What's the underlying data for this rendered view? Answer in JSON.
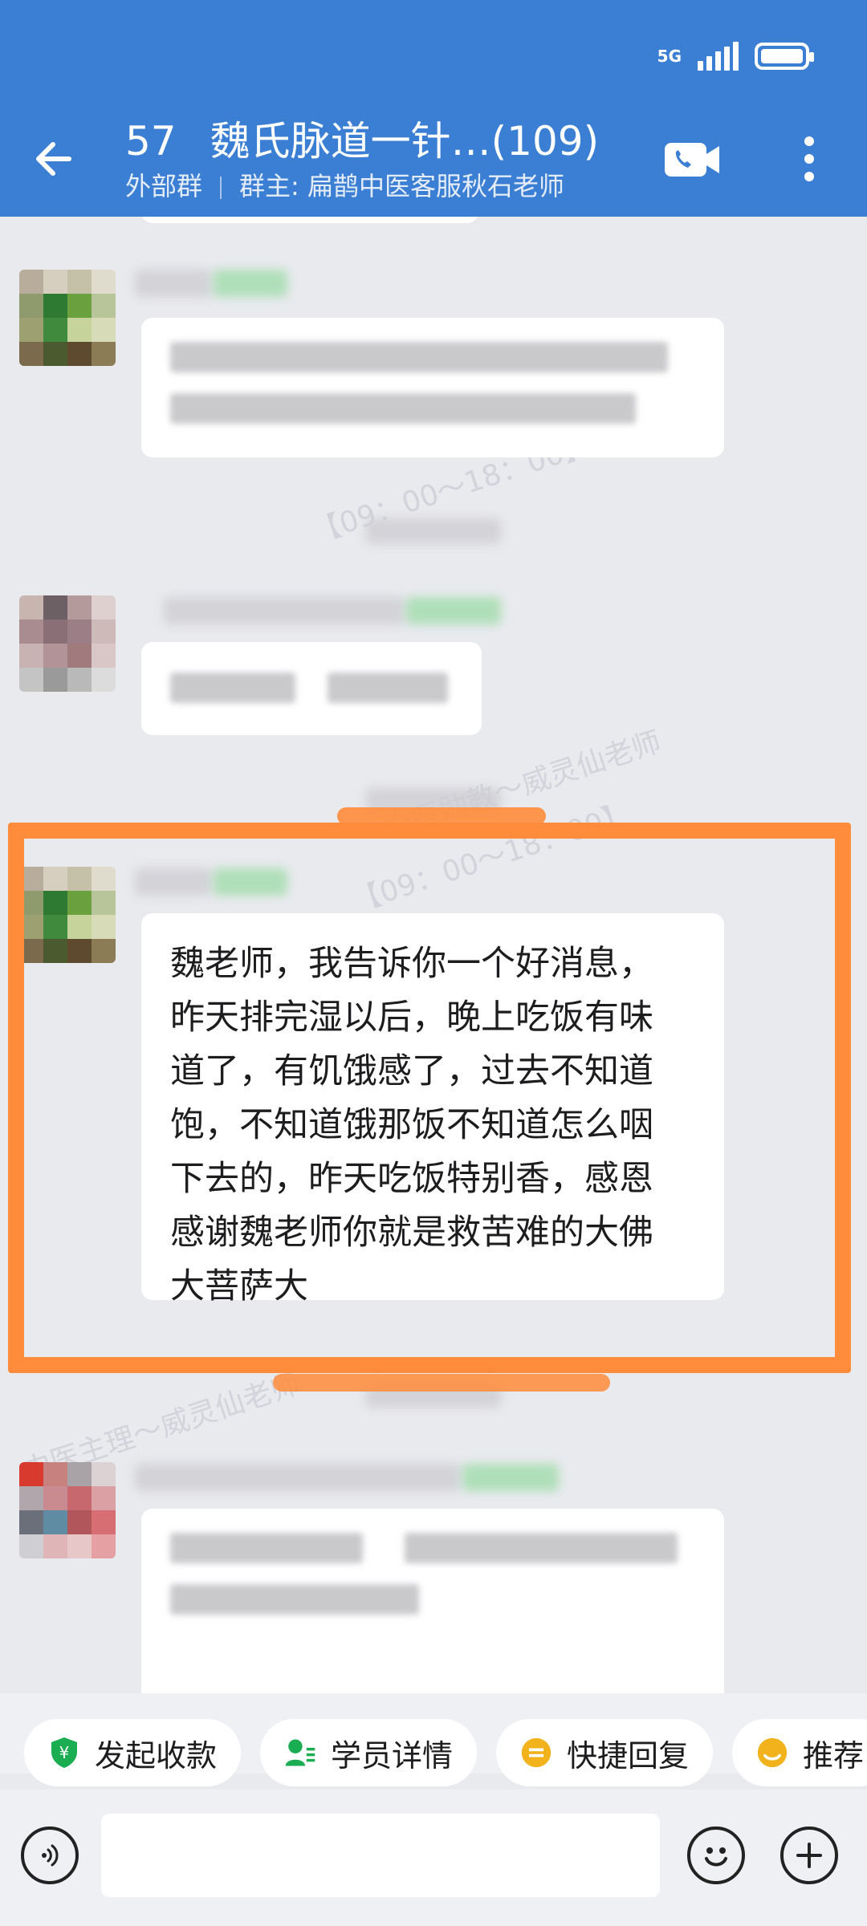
{
  "status_bar": {
    "network": "5G"
  },
  "header": {
    "count": "57",
    "title": "魏氏脉道一针…(109)",
    "group_type": "外部群",
    "owner": "群主: 扁鹊中医客服秋石老师"
  },
  "message": {
    "text": "魏老师，我告诉你一个好消息，昨天排完湿以后，晚上吃饭有味道了，有饥饿感了，过去不知道饱，不知道饿那饭不知道怎么咽下去的，昨天吃饭特别香，感恩感谢魏老师你就是救苦难的大佛大菩萨大"
  },
  "watermarks": [
    "中医助教～威灵仙老师",
    "【09：00～18：00】",
    "中医主理～威灵仙老师"
  ],
  "quick_actions": [
    {
      "label": "发起收款",
      "icon": "payment-shield-icon",
      "color": "#1aad51"
    },
    {
      "label": "学员详情",
      "icon": "student-icon",
      "color": "#1aad51"
    },
    {
      "label": "快捷回复",
      "icon": "quick-reply-icon",
      "color": "#f2b21c"
    },
    {
      "label": "推荐",
      "icon": "recommend-icon",
      "color": "#f2b21c"
    }
  ],
  "highlight_color": "#ff8c3a",
  "header_color": "#3b7fd4"
}
